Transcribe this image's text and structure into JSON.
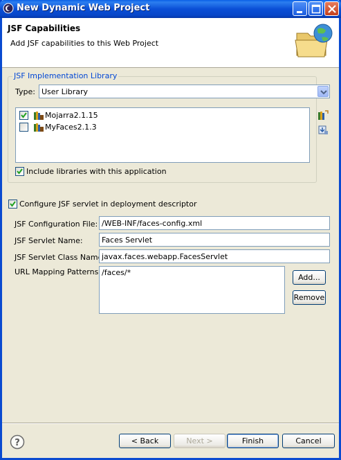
{
  "window": {
    "title": "New Dynamic Web Project"
  },
  "banner": {
    "title": "JSF Capabilities",
    "description": "Add JSF capabilities to this Web Project"
  },
  "library_group": {
    "title": "JSF Implementation Library",
    "type_label": "Type:",
    "type_value": "User Library",
    "libraries": [
      {
        "name": "Mojarra2.1.15",
        "checked": true
      },
      {
        "name": "MyFaces2.1.3",
        "checked": false
      }
    ],
    "include_label": "Include libraries with this application",
    "include_checked": true
  },
  "servlet": {
    "configure_label": "Configure JSF servlet in deployment descriptor",
    "configure_checked": true,
    "config_file_label": "JSF Configuration File:",
    "config_file_value": "/WEB-INF/faces-config.xml",
    "servlet_name_label": "JSF Servlet Name:",
    "servlet_name_value": "Faces Servlet",
    "servlet_class_label": "JSF Servlet Class Name:",
    "servlet_class_value": "javax.faces.webapp.FacesServlet",
    "url_label": "URL Mapping Patterns:",
    "url_patterns": [
      "/faces/*"
    ],
    "add_label": "Add...",
    "remove_label": "Remove"
  },
  "footer": {
    "back_label": "< Back",
    "next_label": "Next >",
    "finish_label": "Finish",
    "cancel_label": "Cancel"
  }
}
